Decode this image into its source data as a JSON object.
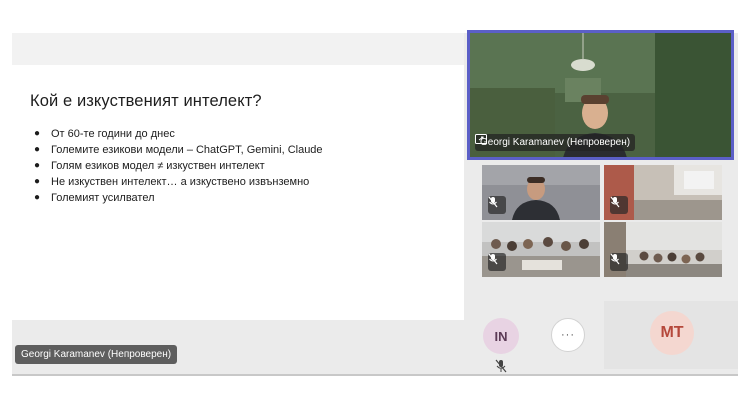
{
  "slide": {
    "title": "Кой е изкуственият интелект?",
    "bullets": [
      "От 60-те години до днес",
      "Големите езикови модели – ChatGPT, Gemini, Claude",
      "Голям езиков модел ≠ изкуствен интелект",
      "Не изкуствен интелект… а изкуствено извънземно",
      "Големият усилвател"
    ]
  },
  "presenter": {
    "name": "Georgi Karamanev (Непроверен)",
    "icon": "screen-share-icon"
  },
  "participants": [
    {
      "id": "tile-1",
      "muted": true
    },
    {
      "id": "tile-2",
      "muted": true
    },
    {
      "id": "tile-3",
      "muted": true
    },
    {
      "id": "tile-4",
      "muted": true
    }
  ],
  "avatars": {
    "in_initials": "IN",
    "mt_initials": "MT",
    "more_label": "···"
  },
  "stage_label": "Georgi Karamanev (Непроверен)",
  "colors": {
    "accent": "#5b5fc7",
    "in_bg": "#e8d3e3",
    "mt_bg": "#f4d7d0",
    "mt_text": "#b5483b"
  }
}
